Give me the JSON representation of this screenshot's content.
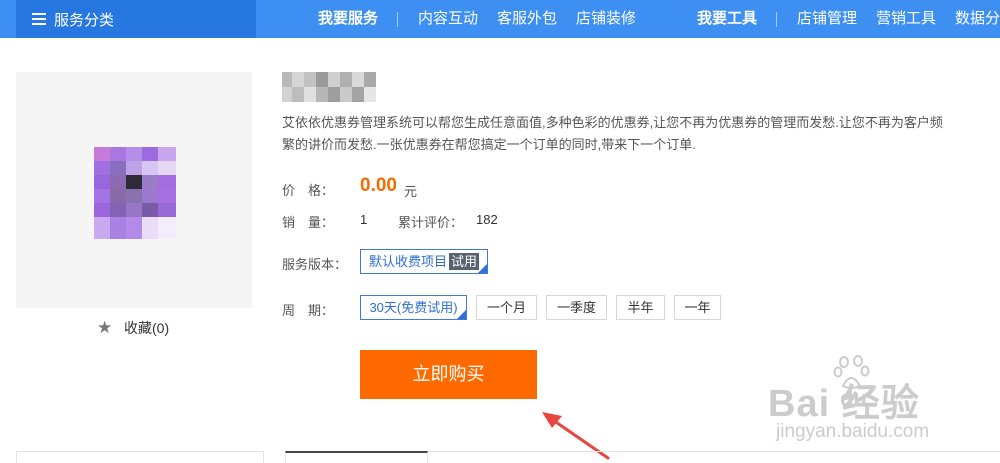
{
  "nav": {
    "category_label": "服务分类",
    "service_group": "我要服务",
    "service_links": [
      "内容互动",
      "客服外包",
      "店铺装修"
    ],
    "tool_group": "我要工具",
    "tool_links": [
      "店铺管理",
      "营销工具",
      "数据分"
    ]
  },
  "product": {
    "description": "艾依依优惠券管理系统可以帮您生成任意面值,多种色彩的优惠券,让您不再为优惠券的管理而发愁.让您不再为客户频繁的讲价而发愁.一张优惠券在帮您搞定一个订单的同时,带来下一个订单.",
    "favorite_label": "收藏(0)",
    "price_label": "价　格：",
    "price": "0.00",
    "price_unit": "元",
    "sales_label": "销　量：",
    "sales": "1",
    "reviews_label": "累计评价：",
    "reviews": "182",
    "version_label": "服务版本：",
    "version_option": "默认收费项目",
    "version_tag": "试用",
    "period_label": "周　期：",
    "period_options": [
      "30天(免费试用)",
      "一个月",
      "一季度",
      "半年",
      "一年"
    ],
    "buy_label": "立即购买"
  },
  "watermark": {
    "brand": "Bai 经验",
    "brand_du": "du",
    "url": "jingyan.baidu.com"
  },
  "colors": {
    "nav_bg": "#3d8ff2",
    "category_bg": "#2677e0",
    "price": "#f56c00",
    "buy_button": "#ff6a00",
    "selected_border": "#3d7be0",
    "arrow": "#e8453c"
  }
}
